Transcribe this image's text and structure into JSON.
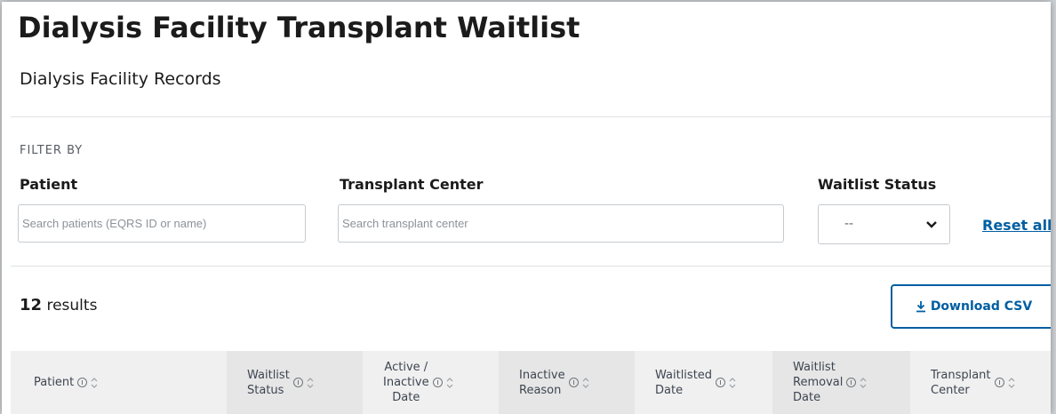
{
  "page": {
    "title": "Dialysis Facility Transplant Waitlist",
    "subtitle": "Dialysis Facility Records"
  },
  "filters": {
    "heading": "FILTER BY",
    "patient": {
      "label": "Patient",
      "placeholder": "Search patients (EQRS ID or name)",
      "value": ""
    },
    "transplant_center": {
      "label": "Transplant Center",
      "placeholder": "Search transplant center",
      "value": ""
    },
    "waitlist_status": {
      "label": "Waitlist Status",
      "selected": "--"
    },
    "reset_label": "Reset all"
  },
  "results": {
    "count": "12",
    "label": "results"
  },
  "download_label": "Download CSV",
  "table": {
    "columns": [
      {
        "lines": [
          "Patient"
        ]
      },
      {
        "lines": [
          "Waitlist",
          "Status"
        ]
      },
      {
        "lines": [
          "Active /",
          "Inactive",
          "Date"
        ]
      },
      {
        "lines": [
          "Inactive",
          "Reason"
        ]
      },
      {
        "lines": [
          "Waitlisted",
          "Date"
        ]
      },
      {
        "lines": [
          "Waitlist",
          "Removal",
          "Date"
        ]
      },
      {
        "lines": [
          "Transplant",
          "Center"
        ]
      }
    ]
  },
  "icons": {
    "download": "download-icon",
    "chevron": "chevron-down-icon",
    "info": "info-icon",
    "sort": "sort-icon"
  },
  "colors": {
    "link": "#005ea2",
    "text": "#1b1b1b",
    "header_bg": "#f0f0f0"
  }
}
